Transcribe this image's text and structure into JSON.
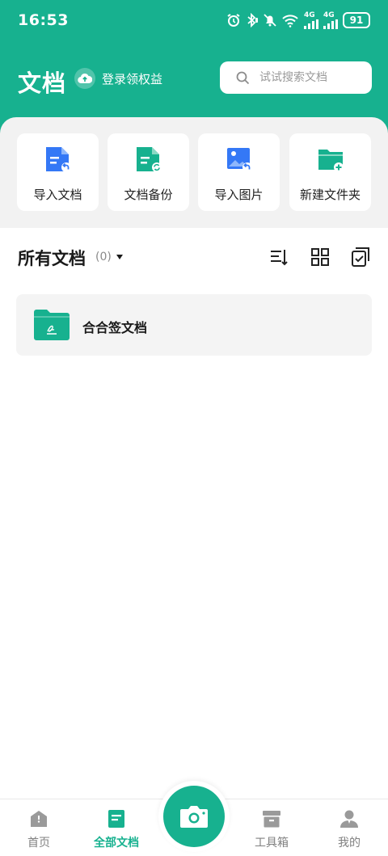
{
  "status_bar": {
    "time": "16:53",
    "network_1": "4G",
    "network_2": "4G",
    "battery": "91",
    "icons": [
      "alarm-icon",
      "bluetooth-icon",
      "mute-bell-icon",
      "wifi-icon",
      "signal-icon",
      "battery-icon"
    ]
  },
  "header": {
    "title": "文档",
    "login_label": "登录领权益",
    "search_placeholder": "试试搜索文档"
  },
  "quick_actions": [
    {
      "label": "导入文档",
      "icon": "import-document-icon"
    },
    {
      "label": "文档备份",
      "icon": "document-backup-icon"
    },
    {
      "label": "导入图片",
      "icon": "import-image-icon"
    },
    {
      "label": "新建文件夹",
      "icon": "new-folder-icon"
    }
  ],
  "documents": {
    "title": "所有文档",
    "count": "(0)",
    "tools": [
      "sort-icon",
      "grid-view-icon",
      "multi-select-icon"
    ],
    "items": [
      {
        "name": "合合签文档",
        "icon": "signature-folder-icon"
      }
    ]
  },
  "bottom_nav": {
    "items": [
      {
        "label": "首页",
        "icon": "home-icon",
        "active": false
      },
      {
        "label": "全部文档",
        "icon": "all-documents-icon",
        "active": true
      },
      {
        "label": "工具箱",
        "icon": "toolbox-icon",
        "active": false
      },
      {
        "label": "我的",
        "icon": "profile-icon",
        "active": false
      }
    ],
    "camera_icon": "camera-icon"
  },
  "colors": {
    "brand": "#17b18f",
    "blue": "#3478f6",
    "panel": "#f2f2f2"
  }
}
